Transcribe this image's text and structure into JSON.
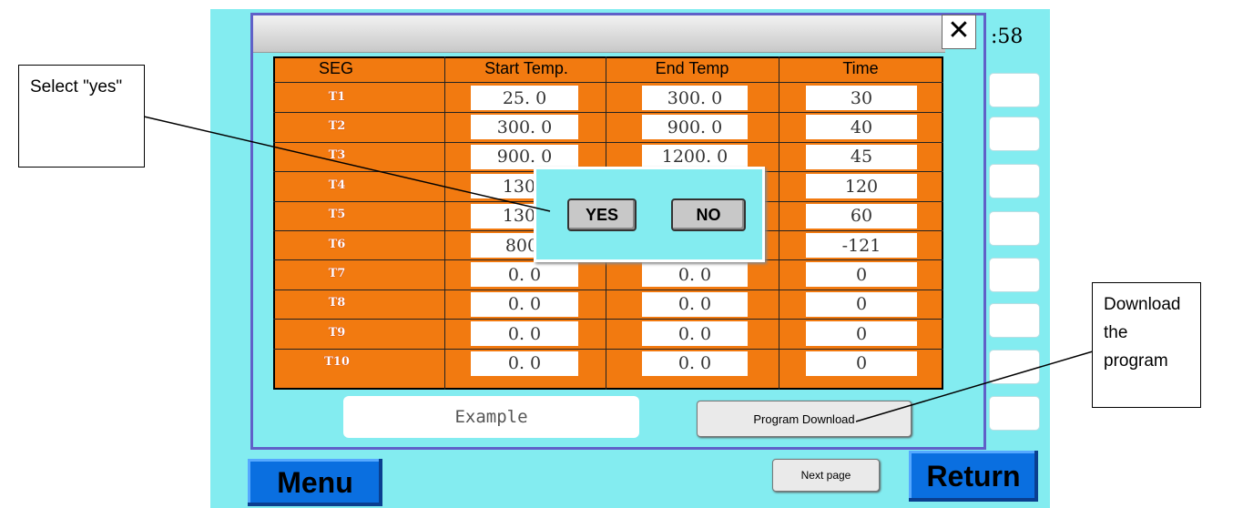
{
  "background": {
    "time_fragment": ":58"
  },
  "dialog": {
    "close_glyph": "✕",
    "table": {
      "headers": [
        "SEG",
        "Start Temp.",
        "End Temp",
        "Time"
      ],
      "rows": [
        {
          "seg": "T1",
          "start": "25. 0",
          "end": "300. 0",
          "time": "30"
        },
        {
          "seg": "T2",
          "start": "300. 0",
          "end": "900. 0",
          "time": "40"
        },
        {
          "seg": "T3",
          "start": "900. 0",
          "end": "1200. 0",
          "time": "45"
        },
        {
          "seg": "T4",
          "start": "1300",
          "end": "",
          "time": "120"
        },
        {
          "seg": "T5",
          "start": "1300",
          "end": "",
          "time": "60"
        },
        {
          "seg": "T6",
          "start": "800.",
          "end": "",
          "time": "-121"
        },
        {
          "seg": "T7",
          "start": "0. 0",
          "end": "0. 0",
          "time": "0"
        },
        {
          "seg": "T8",
          "start": "0. 0",
          "end": "0. 0",
          "time": "0"
        },
        {
          "seg": "T9",
          "start": "0. 0",
          "end": "0. 0",
          "time": "0"
        },
        {
          "seg": "T10",
          "start": "0. 0",
          "end": "0. 0",
          "time": "0"
        }
      ]
    },
    "example_label": "Example",
    "download_button": "Program Download"
  },
  "popup": {
    "yes_label": "YES",
    "no_label": "NO"
  },
  "bottom_bar": {
    "menu_label": "Menu",
    "next_page_label": "Next page",
    "return_label": "Return"
  },
  "callouts": {
    "select_yes": "Select \"yes\"",
    "download": "Download the program"
  },
  "colors": {
    "screen_bg": "#83ecf0",
    "table_orange": "#f27a10",
    "button_blue": "#0a6fe0"
  }
}
